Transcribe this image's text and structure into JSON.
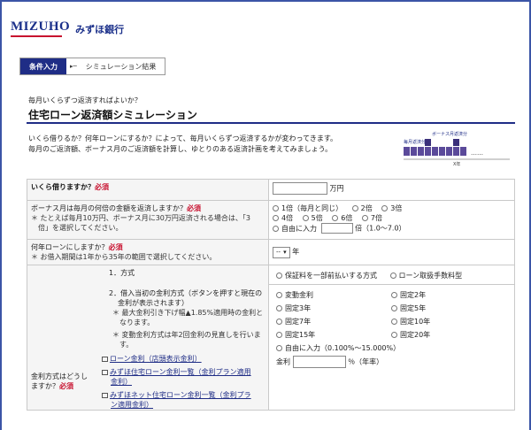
{
  "header": {
    "logo": "MIZUHO",
    "brand": "みずほ銀行"
  },
  "steps": [
    {
      "label": "条件入力"
    },
    {
      "label": "シミュレーション結果"
    }
  ],
  "subtitle": "毎月いくらずつ返済すればよいか？",
  "title": "住宅ローン返済額シミュレーション",
  "intro": {
    "line1": "いくら借りるか？何年ローンにするか？によって、毎月いくらずつ返済するかが変わってきます。",
    "line2": "毎月のご返済額、ボーナス月のご返済額を計算し、ゆとりのある返済計画を考えてみましょう。"
  },
  "diagram": {
    "bonus_label": "ボーナス月返済分",
    "monthly_label": "毎月返済分",
    "years_label": "X年",
    "dots": "……"
  },
  "loan_amount": {
    "question": "いくら借りますか？",
    "required": "必須",
    "unit": "万円",
    "value": ""
  },
  "bonus": {
    "question": "ボーナス月は毎月の何倍の金額を返済しますか？",
    "required": "必須",
    "note1": "＊ たとえば毎月10万円、ボーナス月に30万円返済される場合は、「3",
    "note2": "倍」を選択してください。",
    "options_row1": [
      "1倍（毎月と同じ）",
      "2倍",
      "3倍"
    ],
    "options_row2": [
      "4倍",
      "5倍",
      "6倍",
      "7倍"
    ],
    "free_label": "自由に入力",
    "free_unit": "倍（1.0〜7.0）"
  },
  "term": {
    "question": "何年ローンにしますか？",
    "required": "必須",
    "note": "＊ お借入期間は1年から35年の範囲で選択してください。",
    "select_value": "--",
    "unit": "年"
  },
  "rate": {
    "question1": "金利方式はどうし",
    "question2": "ますか？",
    "required": "必須",
    "method_label": "1．方式",
    "method_options": [
      "保証料を一部前払いする方式",
      "ローン取扱手数料型"
    ],
    "initial_label1": "2．借入当初の金利方式（ボタンを押すと現在の",
    "initial_label2": "金利が表示されます）",
    "note_a1": "＊ 最大金利引き下げ幅▲1.85%適用時の金利と",
    "note_a2": "なります。",
    "note_b1": "＊ 変動金利方式は年2回金利の見直しを行いま",
    "note_b2": "す。",
    "links": [
      "ローン金利（店頭表示金利）",
      "みずほ住宅ローン金利一覧（金利プラン適用",
      "金利）",
      "みずほネット住宅ローン金利一覧（金利プラ",
      "ン適用金利）"
    ],
    "rate_options": [
      "変動金利",
      "固定2年",
      "固定3年",
      "固定5年",
      "固定7年",
      "固定10年",
      "固定15年",
      "固定20年"
    ],
    "free_label": "自由に入力（0.100%〜15.000%）",
    "rate_field_label": "金利",
    "rate_unit": "％（年率）"
  }
}
